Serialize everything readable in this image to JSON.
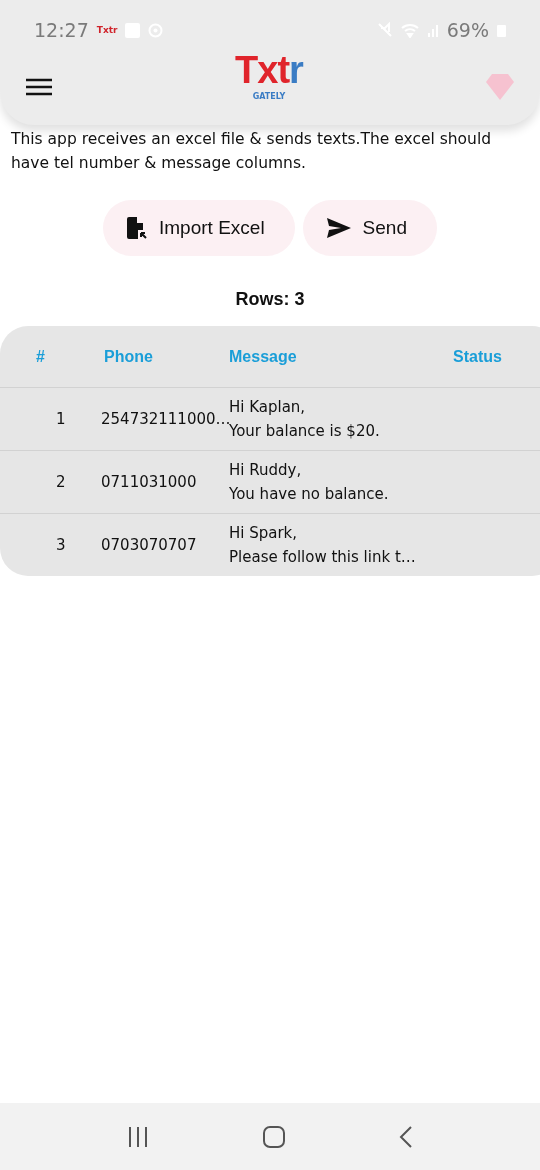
{
  "status_bar": {
    "time": "12:27",
    "notification_logo": "Txtr",
    "battery": "69%"
  },
  "header": {
    "logo_main": "Txt",
    "logo_accent": "r",
    "tagline": "GATELY"
  },
  "description": "This app receives an excel file & sends texts.The excel should have tel number & message columns.",
  "actions": [
    {
      "kind": "import",
      "label": "Import Excel"
    },
    {
      "kind": "send",
      "label": "Send"
    }
  ],
  "row_count": "Rows: 3",
  "table": {
    "columns": [
      "#",
      "Phone",
      "Message",
      "Status"
    ],
    "rows": [
      {
        "index": "1",
        "phone": "254732111000…",
        "message": [
          "Hi Kaplan,",
          "Your balance is $20."
        ]
      },
      {
        "index": "2",
        "phone": "0711031000",
        "message": [
          "Hi Ruddy,",
          "You have no balance."
        ]
      },
      {
        "index": "3",
        "phone": "0703070707",
        "message": [
          "Hi Spark,",
          "Please follow this link t…"
        ]
      }
    ]
  }
}
